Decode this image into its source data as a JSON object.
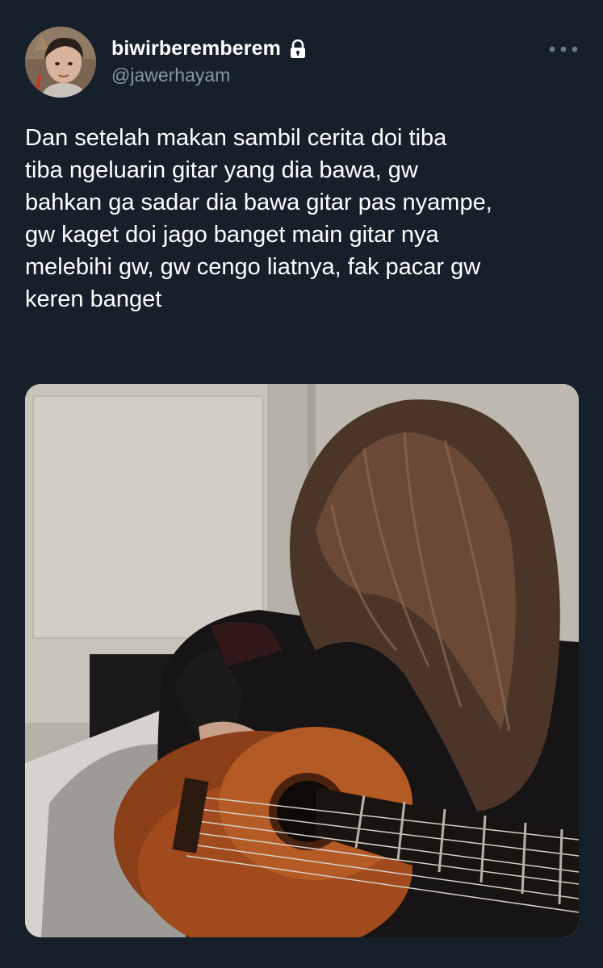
{
  "tweet": {
    "author": {
      "display_name": "biwirberemberem",
      "handle": "@jawerhayam",
      "protected_icon": "lock-icon",
      "avatar": "profile-photo"
    },
    "more_menu_icon": "more-dots-icon",
    "text": "Dan setelah makan sambil cerita doi tiba\ntiba ngeluarin gitar yang dia bawa, gw\nbahkan ga sadar dia bawa gitar pas nyampe,\ngw kaget doi jago banget main gitar nya\nmelebihi gw, gw cengo liatnya, fak pacar gw\nkeren banget",
    "media": {
      "type": "photo"
    }
  },
  "colors": {
    "background": "#15202b",
    "text_primary": "#ffffff",
    "text_secondary": "#8b98a5"
  }
}
